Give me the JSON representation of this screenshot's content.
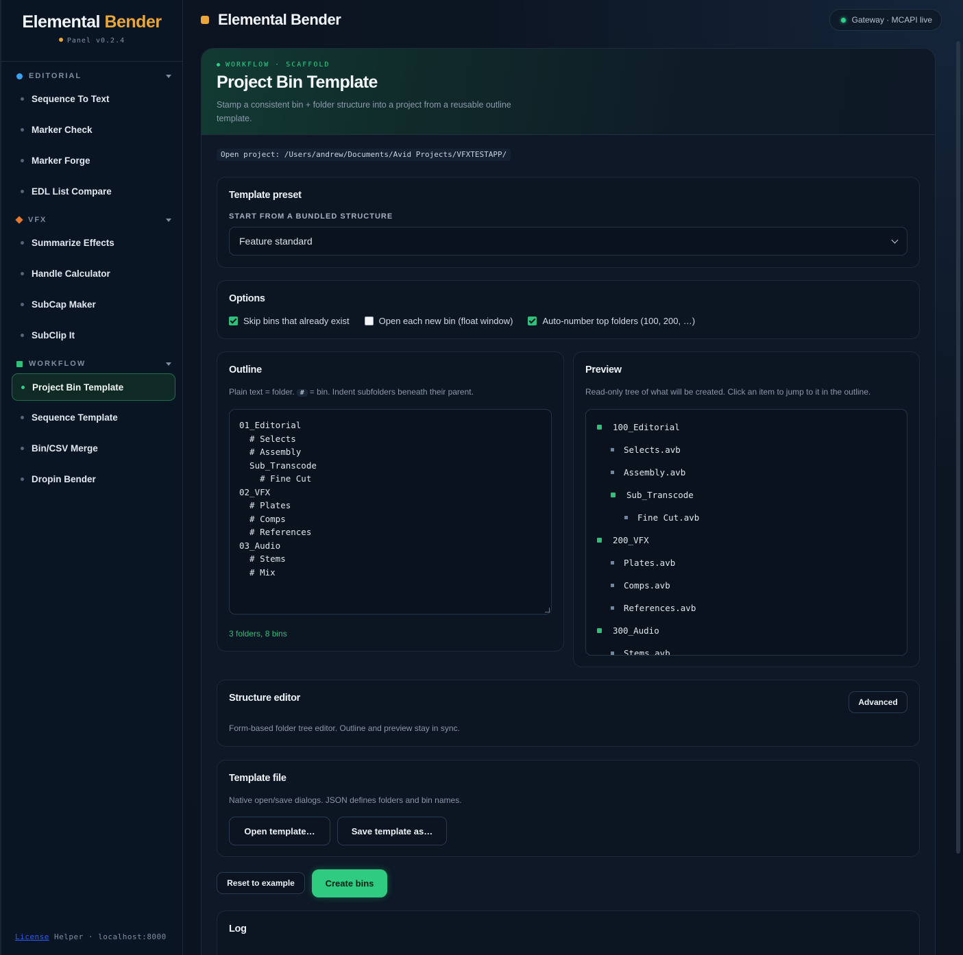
{
  "brand": {
    "name_part1": "Elemental",
    "name_part2": "Bender",
    "version": "Panel v0.2.4"
  },
  "sidebar": {
    "sections": [
      {
        "label": "EDITORIAL",
        "items": [
          "Sequence To Text",
          "Marker Check",
          "Marker Forge",
          "EDL List Compare"
        ]
      },
      {
        "label": "VFX",
        "items": [
          "Summarize Effects",
          "Handle Calculator",
          "SubCap Maker",
          "SubClip It"
        ]
      },
      {
        "label": "WORKFLOW",
        "items": [
          "Project Bin Template",
          "Sequence Template",
          "Bin/CSV Merge",
          "Dropin Bender"
        ]
      }
    ],
    "active_item": "Project Bin Template",
    "footer": {
      "link": "License",
      "helper": "Helper · localhost:8000"
    }
  },
  "header": {
    "title": "Elemental Bender",
    "status": "Gateway · MCAPI live"
  },
  "hero": {
    "eyebrow": "WORKFLOW · SCAFFOLD",
    "title": "Project Bin Template",
    "description": "Stamp a consistent bin + folder structure into a project from a reusable outline template."
  },
  "project_path": "Open project: /Users/andrew/Documents/Avid Projects/VFXTESTAPP/",
  "preset": {
    "title": "Template preset",
    "label": "START FROM A BUNDLED STRUCTURE",
    "selected": "Feature standard"
  },
  "options": {
    "title": "Options",
    "items": [
      {
        "label": "Skip bins that already exist",
        "checked": true
      },
      {
        "label": "Open each new bin (float window)",
        "checked": false
      },
      {
        "label": "Auto-number top folders (100, 200, …)",
        "checked": true
      }
    ]
  },
  "outline": {
    "title": "Outline",
    "hint_before": "Plain text = folder.",
    "hint_chip": "#",
    "hint_after": "= bin. Indent subfolders beneath their parent.",
    "text": "01_Editorial\n  # Selects\n  # Assembly\n  Sub_Transcode\n    # Fine Cut\n02_VFX\n  # Plates\n  # Comps\n  # References\n03_Audio\n  # Stems\n  # Mix",
    "count": "3 folders, 8 bins"
  },
  "preview": {
    "title": "Preview",
    "hint": "Read-only tree of what will be created. Click an item to jump to it in the outline.",
    "items": [
      {
        "label": "100_Editorial",
        "kind": "folder",
        "depth": 0
      },
      {
        "label": "Selects.avb",
        "kind": "bin",
        "depth": 1
      },
      {
        "label": "Assembly.avb",
        "kind": "bin",
        "depth": 1
      },
      {
        "label": "Sub_Transcode",
        "kind": "folder",
        "depth": 1
      },
      {
        "label": "Fine Cut.avb",
        "kind": "bin",
        "depth": 2
      },
      {
        "label": "200_VFX",
        "kind": "folder",
        "depth": 0
      },
      {
        "label": "Plates.avb",
        "kind": "bin",
        "depth": 1
      },
      {
        "label": "Comps.avb",
        "kind": "bin",
        "depth": 1
      },
      {
        "label": "References.avb",
        "kind": "bin",
        "depth": 1
      },
      {
        "label": "300_Audio",
        "kind": "folder",
        "depth": 0
      },
      {
        "label": "Stems.avb",
        "kind": "bin",
        "depth": 1
      }
    ]
  },
  "structure_editor": {
    "title": "Structure editor",
    "hint": "Form-based folder tree editor. Outline and preview stay in sync.",
    "button": "Advanced"
  },
  "template_file": {
    "title": "Template file",
    "hint": "Native open/save dialogs. JSON defines folders and bin names.",
    "open_button": "Open template…",
    "save_button": "Save template as…"
  },
  "actions": {
    "reset": "Reset to example",
    "create": "Create bins"
  },
  "log": {
    "title": "Log"
  },
  "colors": {
    "accent_green": "#2fc07a",
    "accent_orange": "#e8a63b",
    "editorial_blue": "#3ba2f0",
    "vfx_orange": "#e47a2f"
  }
}
